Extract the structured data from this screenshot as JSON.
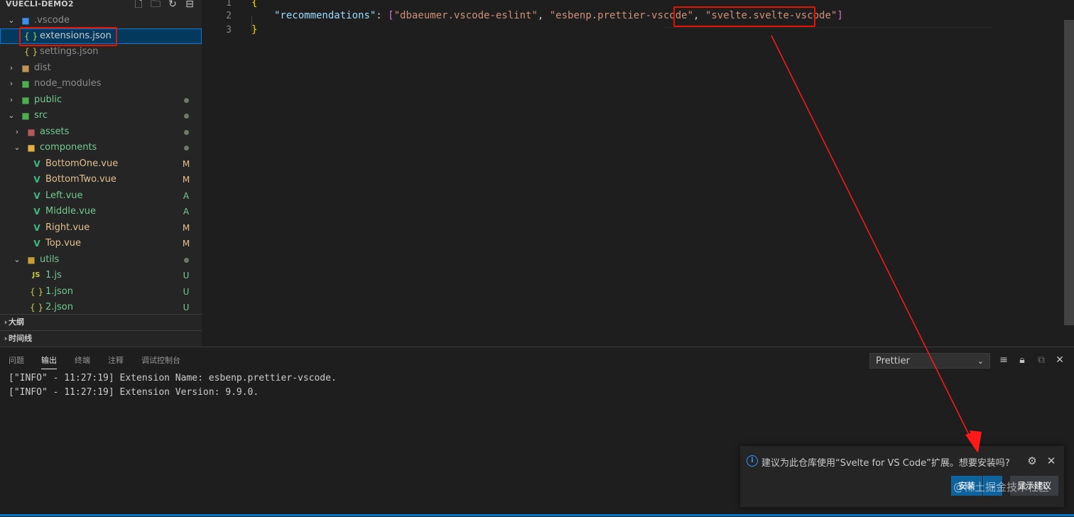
{
  "sidebar": {
    "title": "VUECLI-DEMO2",
    "tools": [
      "new-file-icon",
      "new-folder-icon",
      "refresh-icon",
      "collapse-all-icon"
    ],
    "tree": [
      {
        "label": ".vscode",
        "badge": ""
      },
      {
        "label": "extensions.json",
        "badge": ""
      },
      {
        "label": "settings.json",
        "badge": ""
      },
      {
        "label": "dist",
        "badge": ""
      },
      {
        "label": "node_modules",
        "badge": ""
      },
      {
        "label": "public",
        "badge": ""
      },
      {
        "label": "src",
        "badge": ""
      },
      {
        "label": "assets",
        "badge": ""
      },
      {
        "label": "components",
        "badge": ""
      },
      {
        "label": "BottomOne.vue",
        "badge": "M"
      },
      {
        "label": "BottomTwo.vue",
        "badge": "M"
      },
      {
        "label": "Left.vue",
        "badge": "A"
      },
      {
        "label": "Middle.vue",
        "badge": "A"
      },
      {
        "label": "Right.vue",
        "badge": "M"
      },
      {
        "label": "Top.vue",
        "badge": "M"
      },
      {
        "label": "utils",
        "badge": ""
      },
      {
        "label": "1.js",
        "badge": "U"
      },
      {
        "label": "1.json",
        "badge": "U"
      },
      {
        "label": "2.json",
        "badge": "U"
      }
    ],
    "outline_label": "大纲",
    "timeline_label": "时间线"
  },
  "editor": {
    "line_numbers": [
      "1",
      "2",
      "3"
    ],
    "line1": "{",
    "line2_key": "\"recommendations\"",
    "line2_colon": ": ",
    "line2_open": "[",
    "line2_item1": "\"dbaeumer.vscode-eslint\"",
    "line2_sep": ", ",
    "line2_item2": "\"esbenp.prettier-vscode\"",
    "line2_item3": "\"svelte.svelte-vscode\"",
    "line2_close": "]",
    "line3": "}"
  },
  "panel": {
    "tabs": [
      "问题",
      "输出",
      "终端",
      "注释",
      "调试控制台"
    ],
    "active_tab": "输出",
    "channel": "Prettier",
    "output_lines": [
      "[\"INFO\" - 11:27:19] Extension Name: esbenp.prettier-vscode.",
      "[\"INFO\" - 11:27:19] Extension Version: 9.9.0."
    ]
  },
  "notification": {
    "message": "建议为此仓库使用“Svelte for VS Code”扩展。想要安装吗?",
    "install_label": "安装",
    "show_label": "显示建议"
  },
  "watermark": "@稀土掘金技术社区",
  "colors": {
    "accent": "#007acc",
    "highlight_box": "#e51400",
    "arrow": "#ff1a1a"
  }
}
